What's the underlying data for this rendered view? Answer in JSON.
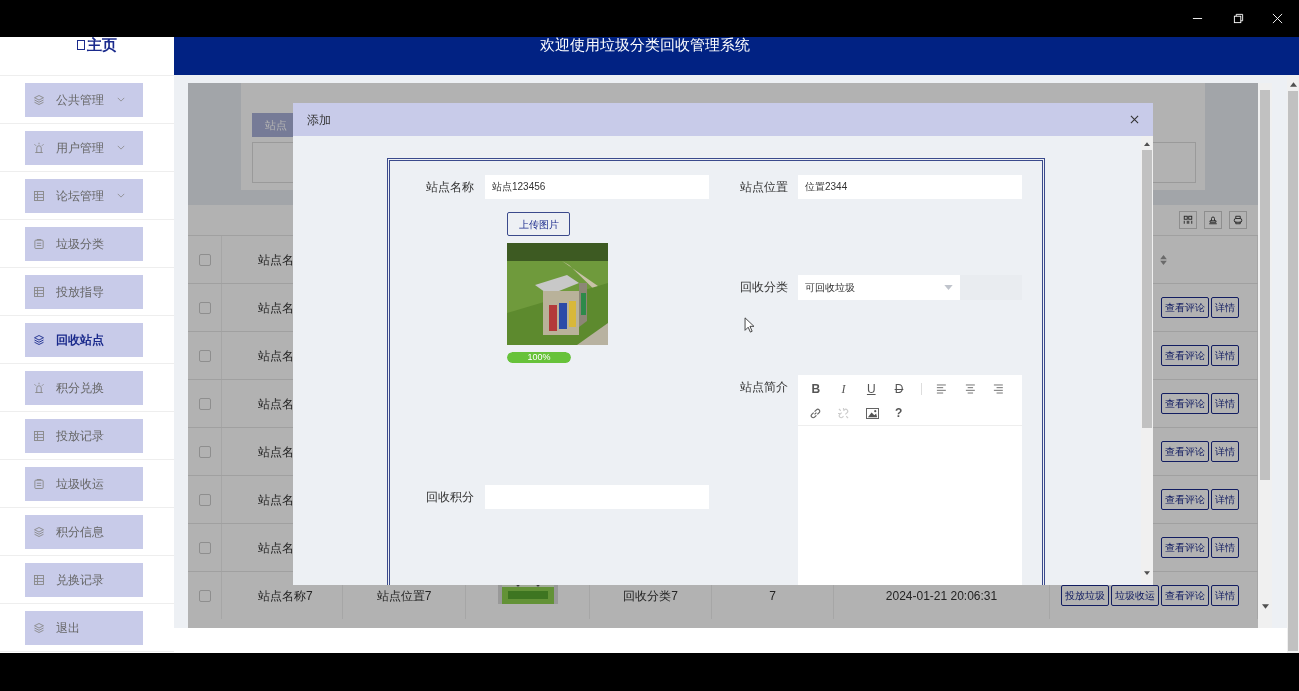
{
  "sidebar": {
    "title": "主页",
    "items": [
      {
        "label": "公共管理",
        "expandable": true,
        "selected": false
      },
      {
        "label": "用户管理",
        "expandable": true,
        "selected": false
      },
      {
        "label": "论坛管理",
        "expandable": true,
        "selected": false
      },
      {
        "label": "垃圾分类",
        "expandable": false,
        "selected": false
      },
      {
        "label": "投放指导",
        "expandable": false,
        "selected": false
      },
      {
        "label": "回收站点",
        "expandable": false,
        "selected": true
      },
      {
        "label": "积分兑换",
        "expandable": false,
        "selected": false
      },
      {
        "label": "投放记录",
        "expandable": false,
        "selected": false
      },
      {
        "label": "垃圾收运",
        "expandable": false,
        "selected": false
      },
      {
        "label": "积分信息",
        "expandable": false,
        "selected": false
      },
      {
        "label": "兑换记录",
        "expandable": false,
        "selected": false
      },
      {
        "label": "退出",
        "expandable": false,
        "selected": false
      }
    ]
  },
  "header": {
    "title": "欢迎使用垃圾分类回收管理系统"
  },
  "background_page": {
    "search_button": "站点",
    "table": {
      "header_checked": false,
      "first_column": "站点名",
      "rows": [
        {
          "checked": false,
          "name": "站点名",
          "actions": [
            "查看评论",
            "详情"
          ]
        },
        {
          "checked": false,
          "name": "站点名",
          "actions": [
            "查看评论",
            "详情"
          ]
        },
        {
          "checked": false,
          "name": "站点名",
          "actions": [
            "查看评论",
            "详情"
          ]
        },
        {
          "checked": false,
          "name": "站点名",
          "actions": [
            "查看评论",
            "详情"
          ]
        },
        {
          "checked": false,
          "name": "站点名",
          "actions": [
            "查看评论",
            "详情"
          ]
        },
        {
          "checked": false,
          "name": "站点名",
          "actions": [
            "查看评论",
            "详情"
          ]
        },
        {
          "checked": false,
          "name": "站点名称7",
          "location": "站点位置7",
          "category": "回收分类7",
          "points": "7",
          "time": "2024-01-21 20:06:31",
          "actions": [
            "投放垃圾",
            "垃圾收运",
            "查看评论",
            "详情"
          ]
        }
      ]
    }
  },
  "modal": {
    "title": "添加",
    "form": {
      "name": {
        "label": "站点名称",
        "value": "站点123456"
      },
      "location": {
        "label": "站点位置",
        "value": "位置2344"
      },
      "upload": {
        "button": "上传图片",
        "progress": {
          "level": 1,
          "reading": "100%"
        }
      },
      "category": {
        "label": "回收分类",
        "value": "可回收垃圾"
      },
      "intro": {
        "label": "站点简介",
        "format_buttons": [
          "B",
          "I",
          "U",
          "D"
        ],
        "help_button": "?",
        "unlink_disabled": true
      },
      "points": {
        "label": "回收积分"
      }
    }
  }
}
